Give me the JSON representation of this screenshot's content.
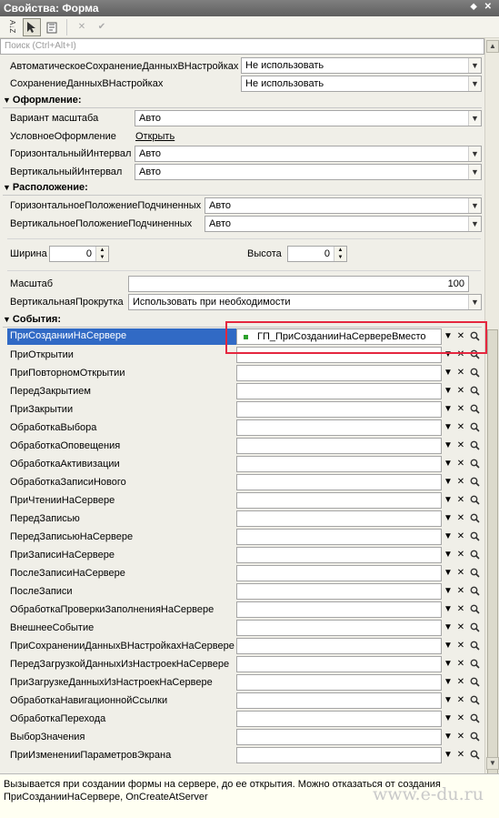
{
  "window": {
    "title": "Свойства: Форма",
    "pin": "⬥",
    "close": "✕"
  },
  "toolbar": {
    "sort_label": "A↓Z",
    "check_label": "✔",
    "cancel_label": "✕"
  },
  "search": {
    "placeholder": "Поиск (Ctrl+Alt+I)"
  },
  "top_props": [
    {
      "label": "АвтоматическоеСохранениеДанныхВНастройках",
      "value": "Не использовать"
    },
    {
      "label": "СохранениеДанныхВНастройках",
      "value": "Не использовать"
    }
  ],
  "sections": {
    "design": "Оформление:",
    "layout": "Расположение:",
    "events": "События:"
  },
  "design": {
    "scale_variant": {
      "label": "Вариант масштаба",
      "value": "Авто"
    },
    "conditional": {
      "label": "УсловноеОформление",
      "link": "Открыть"
    },
    "h_interval": {
      "label": "ГоризонтальныйИнтервал",
      "value": "Авто"
    },
    "v_interval": {
      "label": "ВертикальныйИнтервал",
      "value": "Авто"
    }
  },
  "layout": {
    "h_pos": {
      "label": "ГоризонтальноеПоложениеПодчиненных",
      "value": "Авто"
    },
    "v_pos": {
      "label": "ВертикальноеПоложениеПодчиненных",
      "value": "Авто"
    },
    "width": {
      "label": "Ширина",
      "value": "0"
    },
    "height": {
      "label": "Высота",
      "value": "0"
    },
    "scale": {
      "label": "Масштаб",
      "value": "100"
    },
    "vscroll": {
      "label": "ВертикальнаяПрокрутка",
      "value": "Использовать при необходимости"
    }
  },
  "events": [
    {
      "label": "ПриСозданииНаСервере",
      "value": "ГП_ПриСозданииНаСервереВместо"
    },
    {
      "label": "ПриОткрытии",
      "value": ""
    },
    {
      "label": "ПриПовторномОткрытии",
      "value": ""
    },
    {
      "label": "ПередЗакрытием",
      "value": ""
    },
    {
      "label": "ПриЗакрытии",
      "value": ""
    },
    {
      "label": "ОбработкаВыбора",
      "value": ""
    },
    {
      "label": "ОбработкаОповещения",
      "value": ""
    },
    {
      "label": "ОбработкаАктивизации",
      "value": ""
    },
    {
      "label": "ОбработкаЗаписиНового",
      "value": ""
    },
    {
      "label": "ПриЧтенииНаСервере",
      "value": ""
    },
    {
      "label": "ПередЗаписью",
      "value": ""
    },
    {
      "label": "ПередЗаписьюНаСервере",
      "value": ""
    },
    {
      "label": "ПриЗаписиНаСервере",
      "value": ""
    },
    {
      "label": "ПослеЗаписиНаСервере",
      "value": ""
    },
    {
      "label": "ПослеЗаписи",
      "value": ""
    },
    {
      "label": "ОбработкаПроверкиЗаполненияНаСервере",
      "value": ""
    },
    {
      "label": "ВнешнееСобытие",
      "value": ""
    },
    {
      "label": "ПриСохраненииДанныхВНастройкахНаСервере",
      "value": ""
    },
    {
      "label": "ПередЗагрузкойДанныхИзНастроекНаСервере",
      "value": ""
    },
    {
      "label": "ПриЗагрузкеДанныхИзНастроекНаСервере",
      "value": ""
    },
    {
      "label": "ОбработкаНавигационнойСсылки",
      "value": ""
    },
    {
      "label": "ОбработкаПерехода",
      "value": ""
    },
    {
      "label": "ВыборЗначения",
      "value": ""
    },
    {
      "label": "ПриИзмененииПараметровЭкрана",
      "value": ""
    }
  ],
  "info": {
    "line1": "Вызывается при создании формы на сервере, до ее открытия. Можно отказаться от создания",
    "line2": "ПриСозданииНаСервере, OnCreateAtServer"
  },
  "watermark": "www.e-du.ru",
  "colors": {
    "selection": "#316ac5",
    "highlight_box": "#e5273f"
  }
}
